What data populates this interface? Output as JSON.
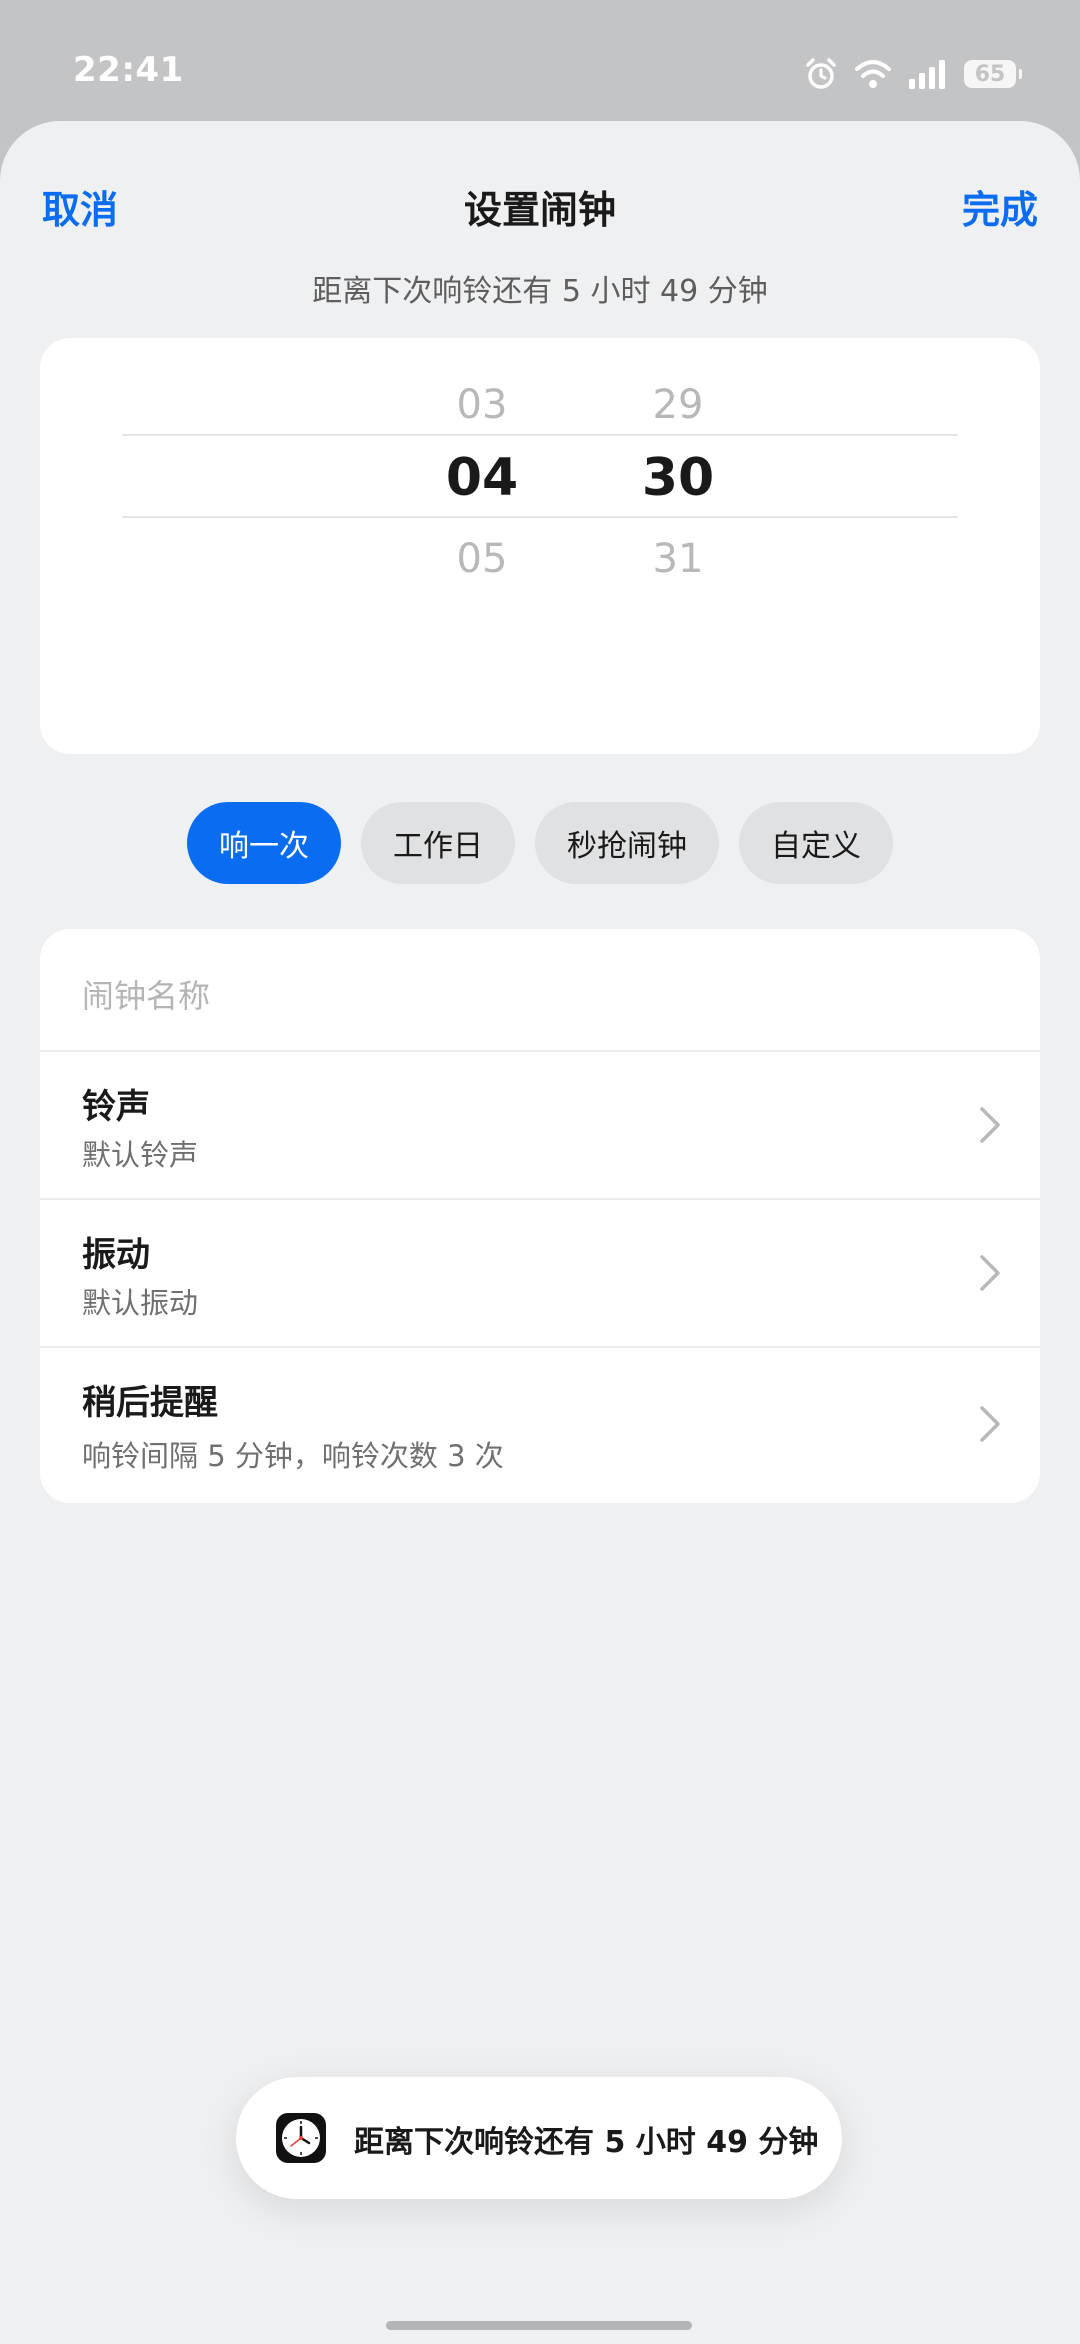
{
  "status_bar": {
    "time": "22:41",
    "battery": "65",
    "icons": [
      "alarm-icon",
      "wifi-icon",
      "signal-icon",
      "battery-icon"
    ]
  },
  "nav": {
    "cancel": "取消",
    "title": "设置闹钟",
    "done": "完成"
  },
  "countdown": "距离下次响铃还有 5 小时 49 分钟",
  "picker": {
    "hours": {
      "prev": "03",
      "current": "04",
      "next": "05"
    },
    "minutes": {
      "prev": "29",
      "current": "30",
      "next": "31"
    }
  },
  "repeat_options": {
    "selected": "响一次",
    "items": [
      {
        "label": "响一次"
      },
      {
        "label": "工作日"
      },
      {
        "label": "秒抢闹钟"
      },
      {
        "label": "自定义"
      }
    ]
  },
  "settings": {
    "name_placeholder": "闹钟名称",
    "ringtone": {
      "title": "铃声",
      "value": "默认铃声"
    },
    "vibration": {
      "title": "振动",
      "value": "默认振动"
    },
    "snooze": {
      "title": "稍后提醒",
      "value": "响铃间隔 5 分钟，响铃次数 3 次"
    }
  },
  "toast": {
    "icon": "clock-app-icon",
    "text": "距离下次响铃还有 5 小时 49 分钟"
  },
  "colors": {
    "accent": "#0a6cf0",
    "sheet_background": "#eff0f2",
    "card": "#ffffff"
  }
}
